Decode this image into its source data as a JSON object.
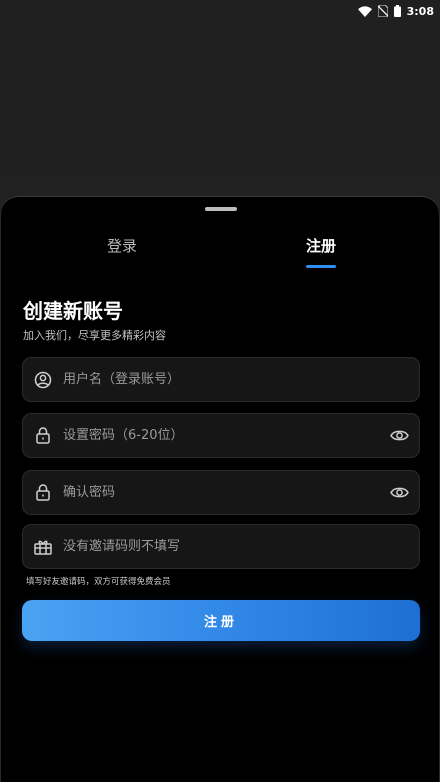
{
  "status_bar": {
    "time": "3:08"
  },
  "tabs": [
    {
      "label": "登录",
      "active": false
    },
    {
      "label": "注册",
      "active": true
    }
  ],
  "form": {
    "title": "创建新账号",
    "subtitle": "加入我们，尽享更多精彩内容",
    "username_placeholder": "用户名（登录账号）",
    "password_placeholder": "设置密码（6-20位）",
    "confirm_placeholder": "确认密码",
    "invite_placeholder": "没有邀请码则不填写",
    "invite_hint": "填写好友邀请码，双方可获得免费会员",
    "submit_label": "注册"
  },
  "colors": {
    "accent": "#2f8cf0",
    "button_start": "#4aa3f3",
    "button_end": "#1e6fd4",
    "sheet_bg": "#000000",
    "field_bg": "#161616"
  },
  "icons": [
    "wifi-icon",
    "no-sim-icon",
    "battery-icon",
    "user-circle-icon",
    "lock-icon",
    "eye-icon",
    "gift-icon"
  ]
}
